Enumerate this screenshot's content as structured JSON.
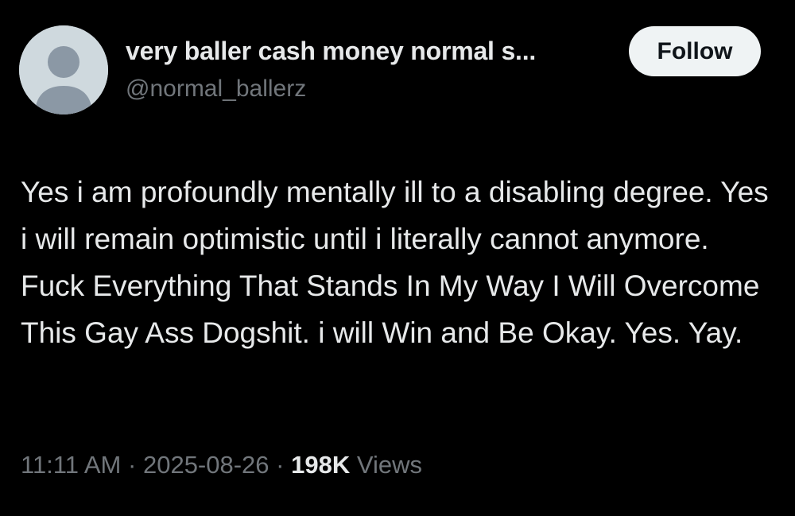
{
  "author": {
    "display_name": "very baller cash money normal s...",
    "handle": "@normal_ballerz",
    "avatar_icon": "default-profile-icon"
  },
  "follow_button": {
    "label": "Follow"
  },
  "tweet": {
    "text": "Yes i am profoundly mentally ill to a disabling degree. Yes i will remain optimistic until i literally cannot anymore. Fuck Everything That Stands In My Way I Will Overcome This Gay Ass Dogshit. i will Win and Be Okay. Yes. Yay."
  },
  "meta": {
    "time": "11:11 AM",
    "separator": "·",
    "date": "2025-08-26",
    "views_count": "198K",
    "views_label": "Views"
  },
  "colors": {
    "background": "#000000",
    "primary_text": "#e7e9ea",
    "secondary_text": "#71767b",
    "follow_bg": "#eff3f4",
    "avatar_bg": "#cfd9de",
    "avatar_silhouette": "#8b98a5"
  }
}
